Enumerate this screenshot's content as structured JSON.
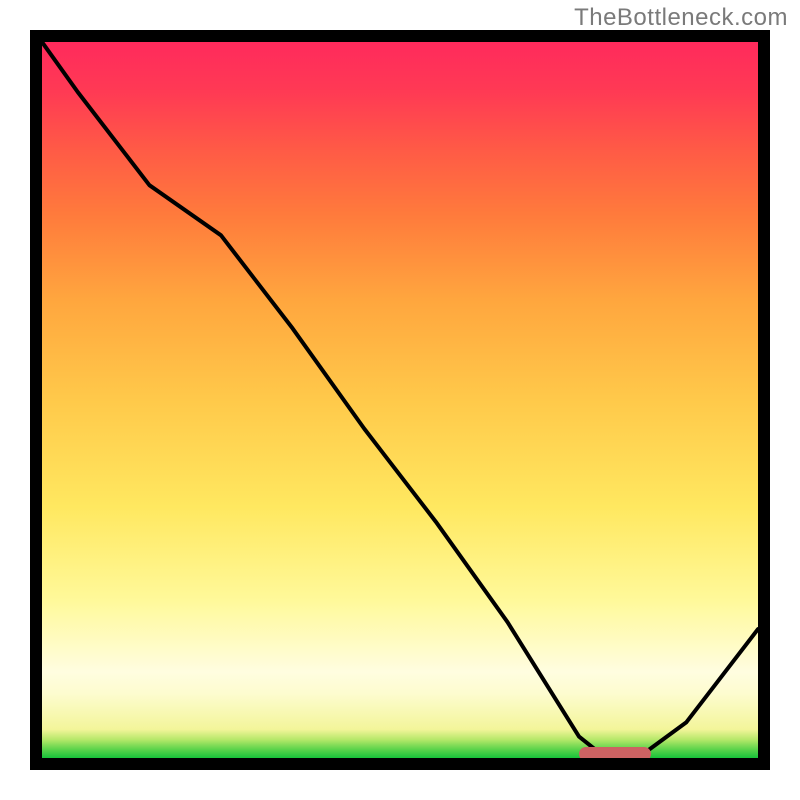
{
  "watermark": "TheBottleneck.com",
  "colors": {
    "curve": "#000000",
    "marker": "#cc6262",
    "axis": "#000000"
  },
  "chart_data": {
    "type": "line",
    "title": "",
    "xlabel": "",
    "ylabel": "",
    "xlim": [
      0,
      100
    ],
    "ylim": [
      0,
      100
    ],
    "grid": false,
    "legend": false,
    "background": "vertical-heatmap",
    "series": [
      {
        "name": "bottleneck-curve",
        "x": [
          0,
          5,
          15,
          25,
          35,
          45,
          55,
          65,
          75,
          78,
          84,
          90,
          100
        ],
        "y": [
          100,
          93,
          80,
          73,
          60,
          46,
          33,
          19,
          3,
          0.6,
          0.6,
          5,
          18
        ]
      }
    ],
    "marker": {
      "name": "optimal-range",
      "x_start": 75,
      "x_end": 85,
      "y": 0.6
    },
    "note": "No axis tick labels are visible in the source image; values are read proportionally from the plot extents."
  }
}
